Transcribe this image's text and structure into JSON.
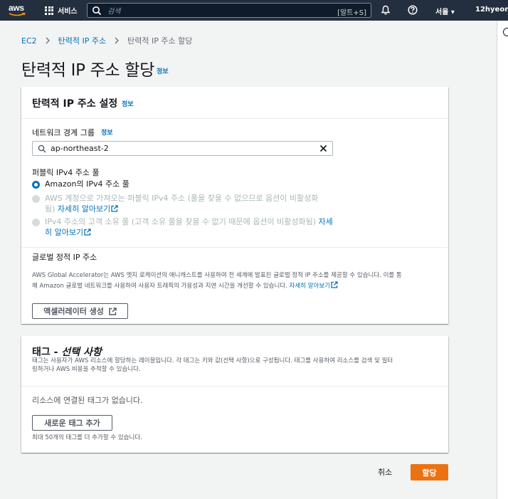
{
  "nav": {
    "logo": "aws",
    "services_label": "서비스",
    "search_placeholder": "검색",
    "search_shortcut": "[알트+S]",
    "region_label": "서울 ▾",
    "user_label": "12hyeon ▾"
  },
  "breadcrumb": {
    "items": [
      "EC2",
      "탄력적 IP 주소"
    ],
    "current": "탄력적 IP 주소 할당"
  },
  "page": {
    "title": "탄력적 IP 주소 할당",
    "info": "정보"
  },
  "settings": {
    "title": "탄력적 IP 주소 설정",
    "info": "정보",
    "nbg_label": "네트워크 경계 그룹",
    "nbg_info": "정보",
    "nbg_value": "ap-northeast-2",
    "pool_label": "퍼블릭 IPv4 주소 풀",
    "options": [
      {
        "label": "Amazon의 IPv4 주소 풀",
        "selected": true
      },
      {
        "line1": "AWS 계정으로 가져오는 퍼블릭 IPv4 주소 (풀을 찾을 수 없으므로 옵션이 비활성화",
        "line2_prefix": "됨)",
        "link": "자세히 알아보기"
      },
      {
        "line1_prefix": "IPv4 주소의 고객 소유 풀 (고객 소유 풀을 찾을 수 없기 때문에 옵션이 비활성화됨)",
        "line1_link": "자세",
        "line2_link": "히 알아보기"
      }
    ],
    "global_title": "글로벌 정적 IP 주소",
    "global_desc_line1": "AWS Global Accelerator는 AWS 엣지 로케이션의 애니캐스트를 사용하여 전 세계에 발표된 글로벌 정적 IP 주소를 제공할 수 있습니다. 이를 통",
    "global_desc_line2": "해 Amazon 글로벌 네트워크를 사용하여 사용자 트래픽의 가용성과 지연 시간을 개선할 수 있습니다.",
    "global_desc_link": "자세히 알아보기",
    "accelerator_button": "액셀러레이터 생성"
  },
  "tags": {
    "title_prefix": "태그 - ",
    "title_optional": "선택 사항",
    "desc_line1": "태그는 사용자가 AWS 리소스에 할당하는 레이블입니다. 각 태그는 키와 값(선택 사항)으로 구성됩니다. 태그를 사용하여 리소스를 검색 및 필터",
    "desc_line2": "링하거나 AWS 비용을 추적할 수 있습니다.",
    "empty": "리소스에 연결된 태그가 없습니다.",
    "add_button": "새로운 태그 추가",
    "limit": "최대 50개의 태그를 더 추가할 수 있습니다."
  },
  "footer": {
    "cancel": "취소",
    "submit": "할당"
  },
  "colors": {
    "nav_bg": "#232f3e",
    "link": "#0073bb",
    "primary": "#ec7211"
  }
}
